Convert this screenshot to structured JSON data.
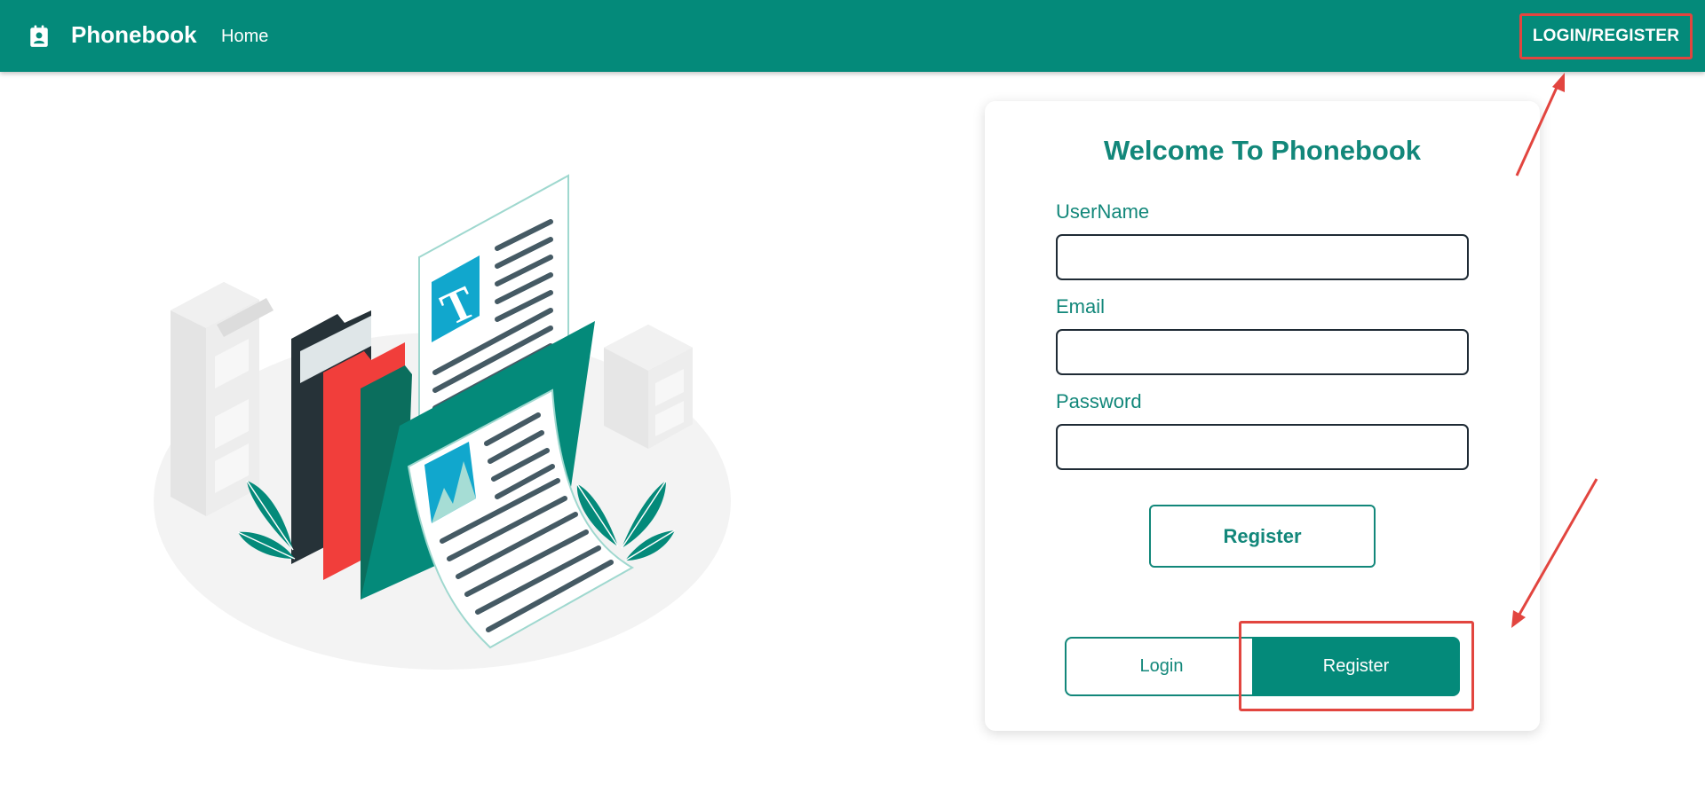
{
  "navbar": {
    "brand": "Phonebook",
    "home_link": "Home",
    "login_register": "LOGIN/REGISTER"
  },
  "form": {
    "title": "Welcome To Phonebook",
    "username_label": "UserName",
    "username_value": "",
    "email_label": "Email",
    "email_value": "",
    "password_label": "Password",
    "password_value": "",
    "submit_label": "Register"
  },
  "toggle": {
    "login_label": "Login",
    "register_label": "Register",
    "active": "Register"
  },
  "colors": {
    "primary": "#048a7a",
    "accent_red": "#e2453f",
    "dark": "#263238"
  },
  "icons": {
    "brand": "contact-book-icon"
  }
}
